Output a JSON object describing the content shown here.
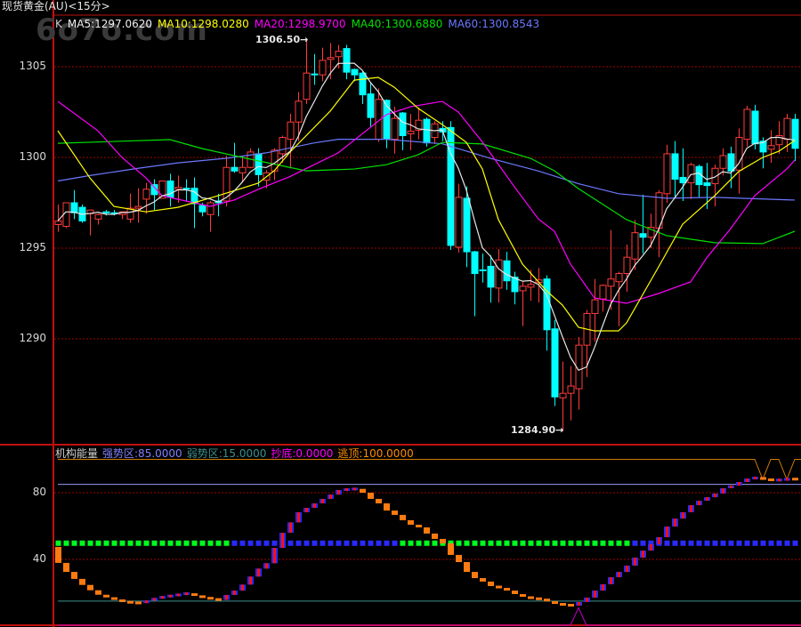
{
  "window": {
    "title": "现货黄金(AU)<15分>",
    "watermark": "6o7o.com"
  },
  "main_legend": {
    "k": "K",
    "ma5": "MA5:1297.0620",
    "ma10": "MA10:1298.0280",
    "ma20": "MA20:1298.9700",
    "ma40": "MA40:1300.6880",
    "ma60": "MA60:1300.8543"
  },
  "indicator_legend": {
    "name": "机构能量",
    "strong": "强势区:85.0000",
    "weak": "弱势区:15.0000",
    "bottom": "抄底:0.0000",
    "top": "逃顶:100.0000"
  },
  "colors": {
    "up": "#ff3c3c",
    "down": "#00ffff",
    "ma5": "#e8e8e8",
    "ma10": "#ffff00",
    "ma20": "#ff00ff",
    "ma40": "#00e000",
    "ma60": "#6b78ff",
    "grid": "#a00000",
    "energy_down": "#ff7a10",
    "energy_up_edge": "#2a2aff",
    "energy_up_core": "#ff1010",
    "dot_green": "#00ff20",
    "dot_blue": "#2a2aff",
    "strong_line": "#9a9aff",
    "weak_line": "#3c9090",
    "bottom_line": "#c000c0",
    "top_line": "#d07a00"
  },
  "chart_data": [
    {
      "type": "candlestick",
      "title": "现货黄金(AU)<15分>",
      "yticks": [
        "1305",
        "1300",
        "1295",
        "1290"
      ],
      "ytick_values": [
        1305,
        1300,
        1295,
        1290
      ],
      "ylim": [
        1282.4,
        1310.6
      ],
      "annotations": {
        "high": "1306.50→",
        "high_value": 1306.5,
        "high_index": 31,
        "low": "1284.90→",
        "low_value": 1284.9,
        "low_index": 63
      },
      "candles_ohlc": [
        [
          1296.3,
          1297.4,
          1295.9,
          1296.5
        ],
        [
          1296.2,
          1297.5,
          1296.1,
          1297.5
        ],
        [
          1297.5,
          1298.2,
          1296.6,
          1296.95
        ],
        [
          1297.25,
          1297.4,
          1296.4,
          1296.5
        ],
        [
          1296.9,
          1297.1,
          1295.7,
          1297.1
        ],
        [
          1296.6,
          1296.9,
          1296.3,
          1296.85
        ],
        [
          1297.0,
          1297.1,
          1296.8,
          1296.95
        ],
        [
          1296.95,
          1297.1,
          1296.8,
          1296.9
        ],
        [
          1296.85,
          1297.0,
          1296.6,
          1297.0
        ],
        [
          1296.6,
          1298.0,
          1296.4,
          1297.2
        ],
        [
          1297.2,
          1298.3,
          1296.4,
          1297.3
        ],
        [
          1297.7,
          1298.6,
          1296.9,
          1298.25
        ],
        [
          1298.5,
          1298.8,
          1297.1,
          1297.95
        ],
        [
          1297.75,
          1298.7,
          1297.75,
          1298.7
        ],
        [
          1298.7,
          1299.1,
          1297.3,
          1297.8
        ],
        [
          1298.25,
          1299.0,
          1297.5,
          1298.35
        ],
        [
          1298.3,
          1298.8,
          1297.6,
          1298.25
        ],
        [
          1298.3,
          1298.9,
          1296.1,
          1297.45
        ],
        [
          1297.35,
          1297.5,
          1296.75,
          1297.0
        ],
        [
          1296.85,
          1297.6,
          1295.9,
          1297.5
        ],
        [
          1297.6,
          1298.0,
          1296.75,
          1297.5
        ],
        [
          1297.6,
          1300.1,
          1297.3,
          1299.45
        ],
        [
          1299.45,
          1300.8,
          1299.15,
          1299.25
        ],
        [
          1299.15,
          1300.1,
          1298.6,
          1299.45
        ],
        [
          1299.45,
          1300.5,
          1299.4,
          1300.3
        ],
        [
          1300.2,
          1300.5,
          1298.4,
          1299.05
        ],
        [
          1298.75,
          1299.3,
          1298.3,
          1299.15
        ],
        [
          1299.25,
          1300.5,
          1298.75,
          1300.4
        ],
        [
          1300.2,
          1301.2,
          1299.7,
          1301.1
        ],
        [
          1301.0,
          1302.4,
          1299.4,
          1301.95
        ],
        [
          1301.95,
          1303.6,
          1300.9,
          1303.1
        ],
        [
          1303.2,
          1306.5,
          1302.95,
          1304.65
        ],
        [
          1304.6,
          1305.7,
          1304.0,
          1304.55
        ],
        [
          1304.55,
          1306.05,
          1304.2,
          1305.35
        ],
        [
          1305.4,
          1306.3,
          1304.3,
          1305.5
        ],
        [
          1305.55,
          1306.2,
          1304.9,
          1305.85
        ],
        [
          1306.0,
          1306.2,
          1304.3,
          1304.7
        ],
        [
          1304.85,
          1304.9,
          1304.2,
          1304.55
        ],
        [
          1304.65,
          1304.8,
          1302.95,
          1303.45
        ],
        [
          1303.5,
          1304.1,
          1301.7,
          1302.2
        ],
        [
          1301.0,
          1303.8,
          1300.85,
          1303.2
        ],
        [
          1303.15,
          1303.2,
          1300.5,
          1301.0
        ],
        [
          1301.0,
          1302.8,
          1300.2,
          1302.15
        ],
        [
          1302.45,
          1302.5,
          1300.4,
          1301.2
        ],
        [
          1301.3,
          1302.4,
          1300.4,
          1301.45
        ],
        [
          1301.5,
          1302.75,
          1301.0,
          1302.05
        ],
        [
          1302.1,
          1302.2,
          1300.6,
          1300.8
        ],
        [
          1301.1,
          1302.0,
          1300.75,
          1301.85
        ],
        [
          1301.6,
          1302.0,
          1300.9,
          1301.4
        ],
        [
          1301.65,
          1302.0,
          1294.9,
          1295.15
        ],
        [
          1295.05,
          1298.55,
          1294.75,
          1297.8
        ],
        [
          1297.75,
          1298.4,
          1293.95,
          1294.8
        ],
        [
          1294.8,
          1294.85,
          1291.25,
          1293.6
        ],
        [
          1293.8,
          1294.7,
          1293.1,
          1293.75
        ],
        [
          1294.0,
          1294.6,
          1292.0,
          1292.85
        ],
        [
          1292.8,
          1294.95,
          1292.0,
          1294.35
        ],
        [
          1294.3,
          1294.8,
          1292.7,
          1293.2
        ],
        [
          1293.4,
          1293.7,
          1291.9,
          1292.6
        ],
        [
          1292.65,
          1293.2,
          1290.7,
          1292.9
        ],
        [
          1292.85,
          1293.8,
          1292.1,
          1293.0
        ],
        [
          1293.1,
          1293.9,
          1292.0,
          1293.25
        ],
        [
          1293.3,
          1293.5,
          1289.35,
          1290.5
        ],
        [
          1290.55,
          1291.05,
          1286.3,
          1286.8
        ],
        [
          1286.75,
          1288.75,
          1284.9,
          1287.0
        ],
        [
          1287.0,
          1288.5,
          1285.5,
          1287.4
        ],
        [
          1287.25,
          1290.1,
          1286.1,
          1289.65
        ],
        [
          1289.65,
          1291.6,
          1287.9,
          1291.4
        ],
        [
          1291.4,
          1293.3,
          1289.85,
          1292.15
        ],
        [
          1292.2,
          1293.0,
          1291.5,
          1292.95
        ],
        [
          1292.9,
          1296.0,
          1291.6,
          1293.3
        ],
        [
          1293.15,
          1293.7,
          1290.7,
          1293.6
        ],
        [
          1293.6,
          1295.2,
          1292.6,
          1294.5
        ],
        [
          1294.4,
          1296.55,
          1293.8,
          1295.85
        ],
        [
          1295.8,
          1297.95,
          1294.7,
          1295.6
        ],
        [
          1295.6,
          1296.9,
          1295.0,
          1296.15
        ],
        [
          1296.1,
          1298.2,
          1294.5,
          1298.05
        ],
        [
          1298.0,
          1300.7,
          1297.5,
          1300.2
        ],
        [
          1300.2,
          1300.9,
          1297.75,
          1298.8
        ],
        [
          1298.9,
          1300.5,
          1297.6,
          1298.6
        ],
        [
          1298.6,
          1299.7,
          1297.7,
          1299.6
        ],
        [
          1299.5,
          1299.6,
          1297.8,
          1298.5
        ],
        [
          1298.6,
          1299.7,
          1297.15,
          1298.45
        ],
        [
          1298.55,
          1299.6,
          1297.3,
          1299.4
        ],
        [
          1299.4,
          1300.5,
          1299.0,
          1300.1
        ],
        [
          1300.2,
          1300.6,
          1298.3,
          1299.25
        ],
        [
          1299.3,
          1301.6,
          1298.0,
          1301.1
        ],
        [
          1301.0,
          1302.85,
          1300.6,
          1302.65
        ],
        [
          1302.55,
          1302.9,
          1300.45,
          1300.75
        ],
        [
          1300.9,
          1301.1,
          1299.4,
          1300.3
        ],
        [
          1300.45,
          1301.5,
          1299.7,
          1300.65
        ],
        [
          1300.7,
          1302.0,
          1300.2,
          1301.2
        ],
        [
          1301.0,
          1302.4,
          1300.3,
          1302.15
        ],
        [
          1302.1,
          1302.4,
          1299.8,
          1300.5
        ]
      ],
      "moving_averages": {
        "ma5": "computed from closes (period 5)",
        "ma10": [
          [
            0,
            1301.47
          ],
          [
            4,
            1298.87
          ],
          [
            7,
            1297.3
          ],
          [
            11,
            1297.0
          ],
          [
            15,
            1297.25
          ],
          [
            20,
            1297.89
          ],
          [
            25,
            1298.58
          ],
          [
            27,
            1299.26
          ],
          [
            29,
            1300.3
          ],
          [
            34,
            1302.55
          ],
          [
            37,
            1304.26
          ],
          [
            40,
            1304.41
          ],
          [
            42,
            1303.87
          ],
          [
            45,
            1302.7
          ],
          [
            48,
            1301.81
          ],
          [
            51,
            1300.83
          ],
          [
            53,
            1299.36
          ],
          [
            55,
            1296.57
          ],
          [
            58,
            1294.12
          ],
          [
            61,
            1292.65
          ],
          [
            63,
            1291.86
          ],
          [
            65,
            1290.64
          ],
          [
            67,
            1290.44
          ],
          [
            70,
            1290.44
          ],
          [
            71,
            1290.88
          ],
          [
            75,
            1293.97
          ],
          [
            78,
            1296.32
          ],
          [
            82,
            1297.89
          ],
          [
            85,
            1299.22
          ],
          [
            88,
            1300.0
          ],
          [
            90,
            1300.34
          ],
          [
            92,
            1300.93
          ]
        ],
        "ma20": [
          [
            0,
            1303.09
          ],
          [
            5,
            1301.47
          ],
          [
            8,
            1300.0
          ],
          [
            11,
            1298.87
          ],
          [
            13,
            1297.89
          ],
          [
            17,
            1297.5
          ],
          [
            19,
            1297.3
          ],
          [
            22,
            1297.65
          ],
          [
            25,
            1298.24
          ],
          [
            29,
            1298.95
          ],
          [
            35,
            1300.25
          ],
          [
            41,
            1302.35
          ],
          [
            44,
            1302.79
          ],
          [
            48,
            1303.09
          ],
          [
            50,
            1302.5
          ],
          [
            53,
            1300.85
          ],
          [
            57,
            1298.38
          ],
          [
            60,
            1296.6
          ],
          [
            62,
            1295.93
          ],
          [
            64,
            1294.12
          ],
          [
            67,
            1292.25
          ],
          [
            71,
            1291.96
          ],
          [
            75,
            1292.5
          ],
          [
            79,
            1293.14
          ],
          [
            81,
            1294.46
          ],
          [
            84,
            1296.08
          ],
          [
            87,
            1297.89
          ],
          [
            91,
            1299.36
          ],
          [
            92,
            1299.85
          ]
        ],
        "ma40": [
          [
            0,
            1300.78
          ],
          [
            14,
            1300.98
          ],
          [
            18,
            1300.49
          ],
          [
            23,
            1300.0
          ],
          [
            31,
            1299.26
          ],
          [
            37,
            1299.36
          ],
          [
            41,
            1299.6
          ],
          [
            45,
            1300.15
          ],
          [
            48,
            1300.83
          ],
          [
            53,
            1300.74
          ],
          [
            59,
            1299.95
          ],
          [
            62,
            1299.26
          ],
          [
            65,
            1298.28
          ],
          [
            71,
            1296.57
          ],
          [
            76,
            1295.69
          ],
          [
            82,
            1295.3
          ],
          [
            88,
            1295.25
          ],
          [
            92,
            1295.93
          ]
        ],
        "ma60": [
          [
            0,
            1298.7
          ],
          [
            4,
            1299.0
          ],
          [
            10,
            1299.4
          ],
          [
            15,
            1299.7
          ],
          [
            21,
            1299.95
          ],
          [
            26,
            1300.25
          ],
          [
            32,
            1300.8
          ],
          [
            35,
            1301.0
          ],
          [
            41,
            1301.0
          ],
          [
            48,
            1300.75
          ],
          [
            54,
            1299.95
          ],
          [
            60,
            1299.25
          ],
          [
            65,
            1298.55
          ],
          [
            70,
            1298.0
          ],
          [
            76,
            1297.75
          ],
          [
            82,
            1297.8
          ],
          [
            92,
            1297.65
          ]
        ]
      }
    },
    {
      "type": "bar",
      "title": "机构能量",
      "yticks": [
        "80",
        "40"
      ],
      "ytick_values": [
        80,
        40
      ],
      "ylim": [
        0,
        108
      ],
      "levels": {
        "top": 100,
        "strong": 85,
        "weak": 15,
        "bottom": 0
      },
      "energy_start": 47.5,
      "energy": [
        37.9,
        32.5,
        28.3,
        24.7,
        21.5,
        18.8,
        17.2,
        15.8,
        14.6,
        14.0,
        13.8,
        15.5,
        16.7,
        17.8,
        18.2,
        19.2,
        19.7,
        18.1,
        17.2,
        16.2,
        15.7,
        18.7,
        21.3,
        24.9,
        29.7,
        34.5,
        37.7,
        46.9,
        56.0,
        62.2,
        68.3,
        70.9,
        73.6,
        76.3,
        78.9,
        81.6,
        82.1,
        82.3,
        80.0,
        76.3,
        73.6,
        69.3,
        66.7,
        63.5,
        60.8,
        59.2,
        55.5,
        52.3,
        49.6,
        42.7,
        38.4,
        32.5,
        28.8,
        26.7,
        24.0,
        22.9,
        21.3,
        19.2,
        17.6,
        16.5,
        16.3,
        15.0,
        13.3,
        12.8,
        12.3,
        14.4,
        17.1,
        21.3,
        25.1,
        29.3,
        32.5,
        36.3,
        41.1,
        45.3,
        49.1,
        53.3,
        59.7,
        64.5,
        68.3,
        72.5,
        75.2,
        77.3,
        79.5,
        82.7,
        84.3,
        86.4,
        88.5,
        89.1,
        88.0,
        87.5,
        87.7,
        88.3,
        88.0
      ],
      "midline_value": 50,
      "midline_dot_runs": [
        {
          "from": 0,
          "to": 21,
          "color": "green"
        },
        {
          "from": 22,
          "to": 42,
          "color": "blue"
        },
        {
          "from": 43,
          "to": 71,
          "color": "green"
        },
        {
          "from": 72,
          "to": 92,
          "color": "blue"
        }
      ],
      "top_signals": [
        88,
        91
      ],
      "top_signal_depth": 88,
      "bottom_signals": [
        65
      ],
      "bottom_signal_height": 11
    }
  ]
}
